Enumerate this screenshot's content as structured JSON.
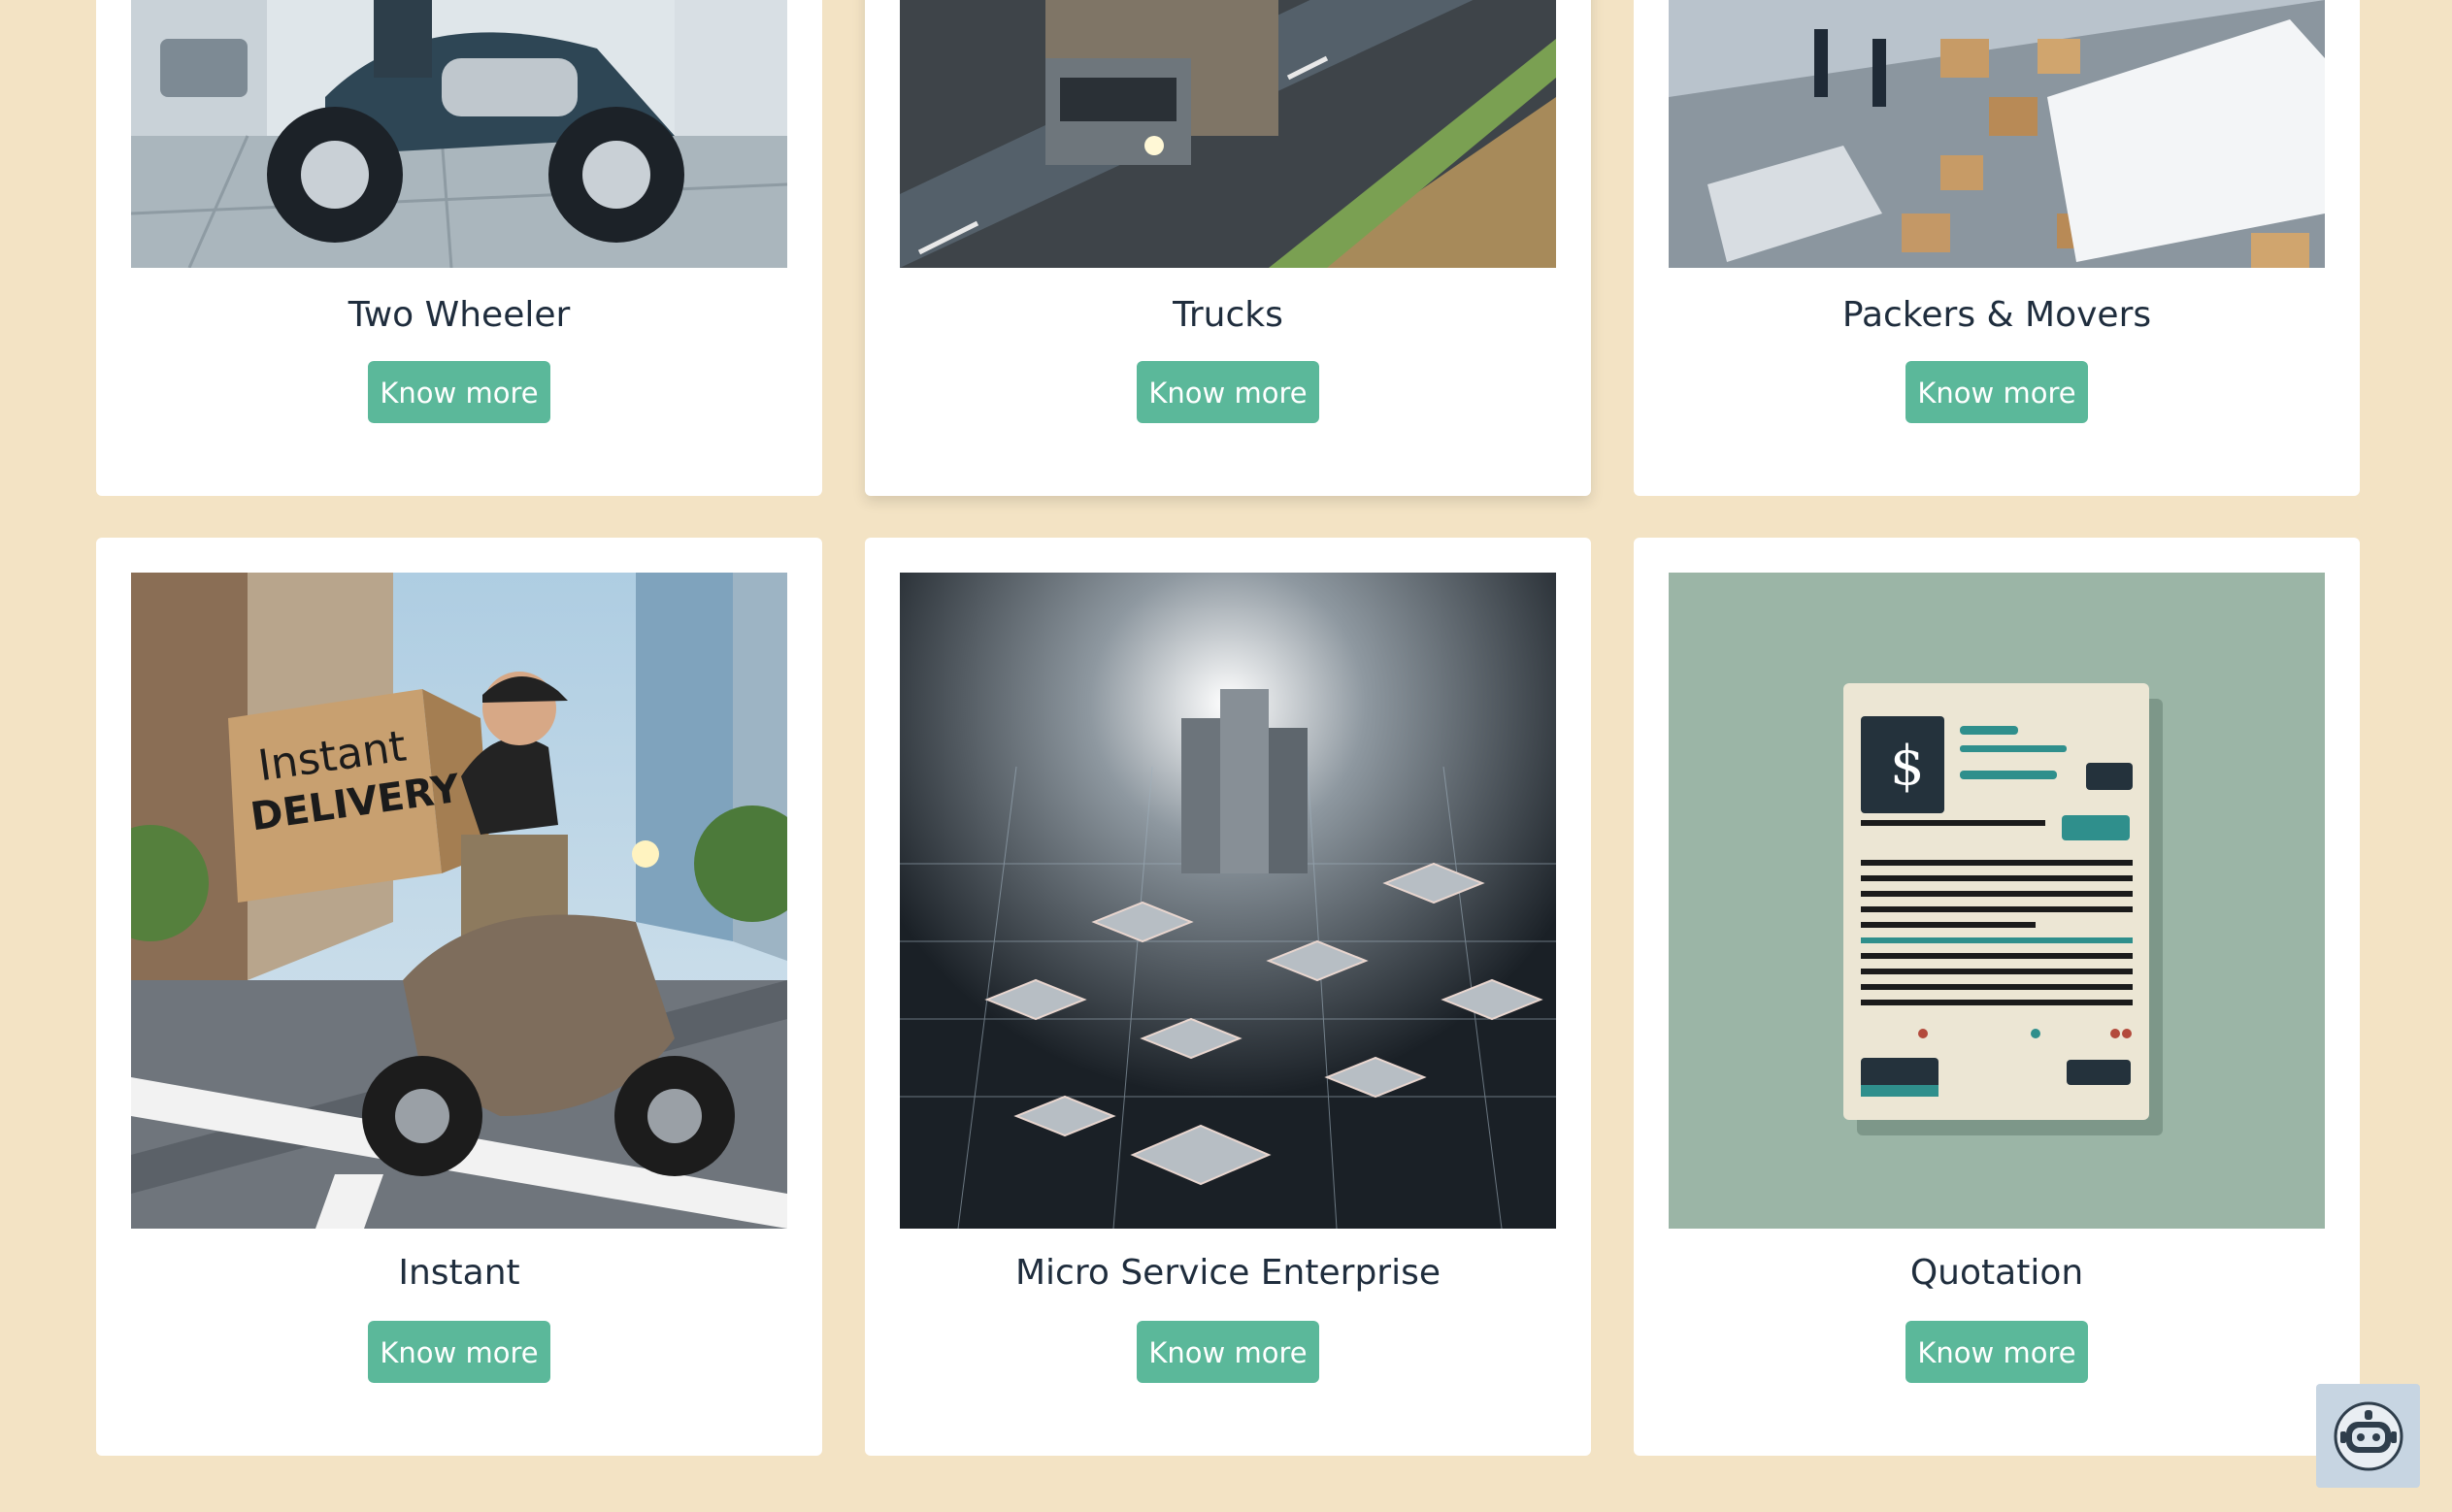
{
  "services": [
    {
      "title": "Two Wheeler",
      "button": "Know more",
      "image": "scooter-photo"
    },
    {
      "title": "Trucks",
      "button": "Know more",
      "image": "truck-road-photo"
    },
    {
      "title": "Packers & Movers",
      "button": "Know more",
      "image": "moving-boxes-photo"
    },
    {
      "title": "Instant",
      "button": "Know more",
      "image": "instant-delivery-scooter-photo",
      "image_text": [
        "Instant",
        "DELIVERY"
      ]
    },
    {
      "title": "Micro Service Enterprise",
      "button": "Know more",
      "image": "network-city-photo"
    },
    {
      "title": "Quotation",
      "button": "Know more",
      "image": "quotation-document-illustration"
    }
  ],
  "chatbot": {
    "icon": "robot-icon"
  },
  "colors": {
    "page_background": "#f3e3c4",
    "card_background": "#ffffff",
    "button": "#5bb89a",
    "title_text": "#1f2d3d"
  }
}
